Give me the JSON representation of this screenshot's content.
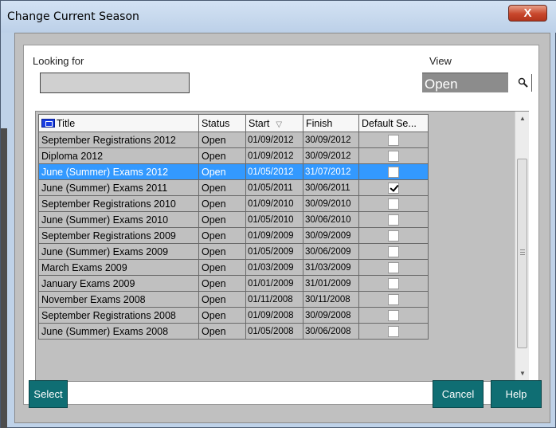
{
  "window": {
    "title": "Change Current Season",
    "close_label": "X"
  },
  "search": {
    "looking_for_label": "Looking for",
    "looking_for_value": "",
    "view_label": "View",
    "view_value": "Open"
  },
  "grid": {
    "columns": [
      "Title",
      "Status",
      "Start",
      "Finish",
      "Default Se..."
    ],
    "sort_column": "Start",
    "rows": [
      {
        "title": "September Registrations 2012",
        "status": "Open",
        "start": "01/09/2012",
        "finish": "30/09/2012",
        "default": false,
        "selected": false
      },
      {
        "title": "Diploma 2012",
        "status": "Open",
        "start": "01/09/2012",
        "finish": "30/09/2012",
        "default": false,
        "selected": false
      },
      {
        "title": "June (Summer) Exams 2012",
        "status": "Open",
        "start": "01/05/2012",
        "finish": "31/07/2012",
        "default": false,
        "selected": true
      },
      {
        "title": "June (Summer) Exams 2011",
        "status": "Open",
        "start": "01/05/2011",
        "finish": "30/06/2011",
        "default": true,
        "selected": false
      },
      {
        "title": "September Registrations 2010",
        "status": "Open",
        "start": "01/09/2010",
        "finish": "30/09/2010",
        "default": false,
        "selected": false
      },
      {
        "title": "June (Summer) Exams 2010",
        "status": "Open",
        "start": "01/05/2010",
        "finish": "30/06/2010",
        "default": false,
        "selected": false
      },
      {
        "title": "September Registrations 2009",
        "status": "Open",
        "start": "01/09/2009",
        "finish": "30/09/2009",
        "default": false,
        "selected": false
      },
      {
        "title": "June (Summer) Exams 2009",
        "status": "Open",
        "start": "01/05/2009",
        "finish": "30/06/2009",
        "default": false,
        "selected": false
      },
      {
        "title": "March Exams 2009",
        "status": "Open",
        "start": "01/03/2009",
        "finish": "31/03/2009",
        "default": false,
        "selected": false
      },
      {
        "title": "January Exams 2009",
        "status": "Open",
        "start": "01/01/2009",
        "finish": "31/01/2009",
        "default": false,
        "selected": false
      },
      {
        "title": "November Exams 2008",
        "status": "Open",
        "start": "01/11/2008",
        "finish": "30/11/2008",
        "default": false,
        "selected": false
      },
      {
        "title": "September Registrations 2008",
        "status": "Open",
        "start": "01/09/2008",
        "finish": "30/09/2008",
        "default": false,
        "selected": false
      },
      {
        "title": "June (Summer) Exams 2008",
        "status": "Open",
        "start": "01/05/2008",
        "finish": "30/06/2008",
        "default": false,
        "selected": false
      }
    ]
  },
  "buttons": {
    "select": "Select",
    "cancel": "Cancel",
    "help": "Help"
  },
  "colors": {
    "selection": "#3399ff",
    "button": "#0f6e73",
    "grid_bg": "#c0c0c0"
  },
  "icons": {
    "view_search": "magnifier-icon",
    "title_header": "table-icon",
    "sort": "sort-descending-icon"
  }
}
